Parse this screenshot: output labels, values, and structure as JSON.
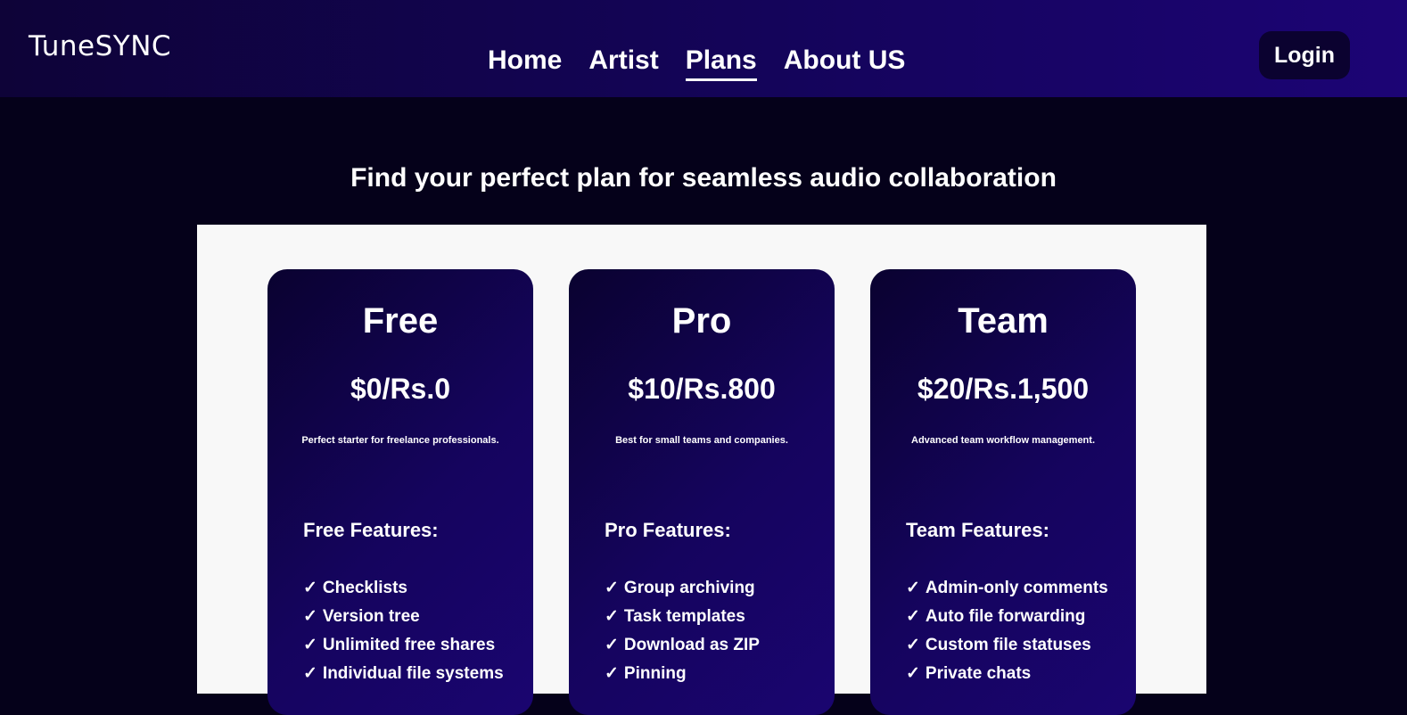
{
  "header": {
    "logo": "TuneSYNC",
    "nav": [
      {
        "label": "Home"
      },
      {
        "label": "Artist"
      },
      {
        "label": "Plans",
        "active": true
      },
      {
        "label": "About US"
      }
    ],
    "login_label": "Login"
  },
  "headline": "Find your perfect plan for seamless audio collaboration",
  "check_mark": "✓",
  "plans": [
    {
      "name": "Free",
      "price": "$0/Rs.0",
      "description": "Perfect starter for freelance professionals.",
      "features_heading": "Free Features:",
      "features": [
        "Checklists",
        "Version tree",
        "Unlimited free shares",
        "Individual file systems"
      ]
    },
    {
      "name": "Pro",
      "price": "$10/Rs.800",
      "description": "Best for small teams and companies.",
      "features_heading": "Pro Features:",
      "features": [
        "Group archiving",
        "Task templates",
        "Download as ZIP",
        "Pinning"
      ]
    },
    {
      "name": "Team",
      "price": "$20/Rs.1,500",
      "description": "Advanced team workflow management.",
      "features_heading": "Team Features:",
      "features": [
        "Admin-only comments",
        "Auto file forwarding",
        "Custom file statuses",
        "Private chats"
      ]
    }
  ]
}
